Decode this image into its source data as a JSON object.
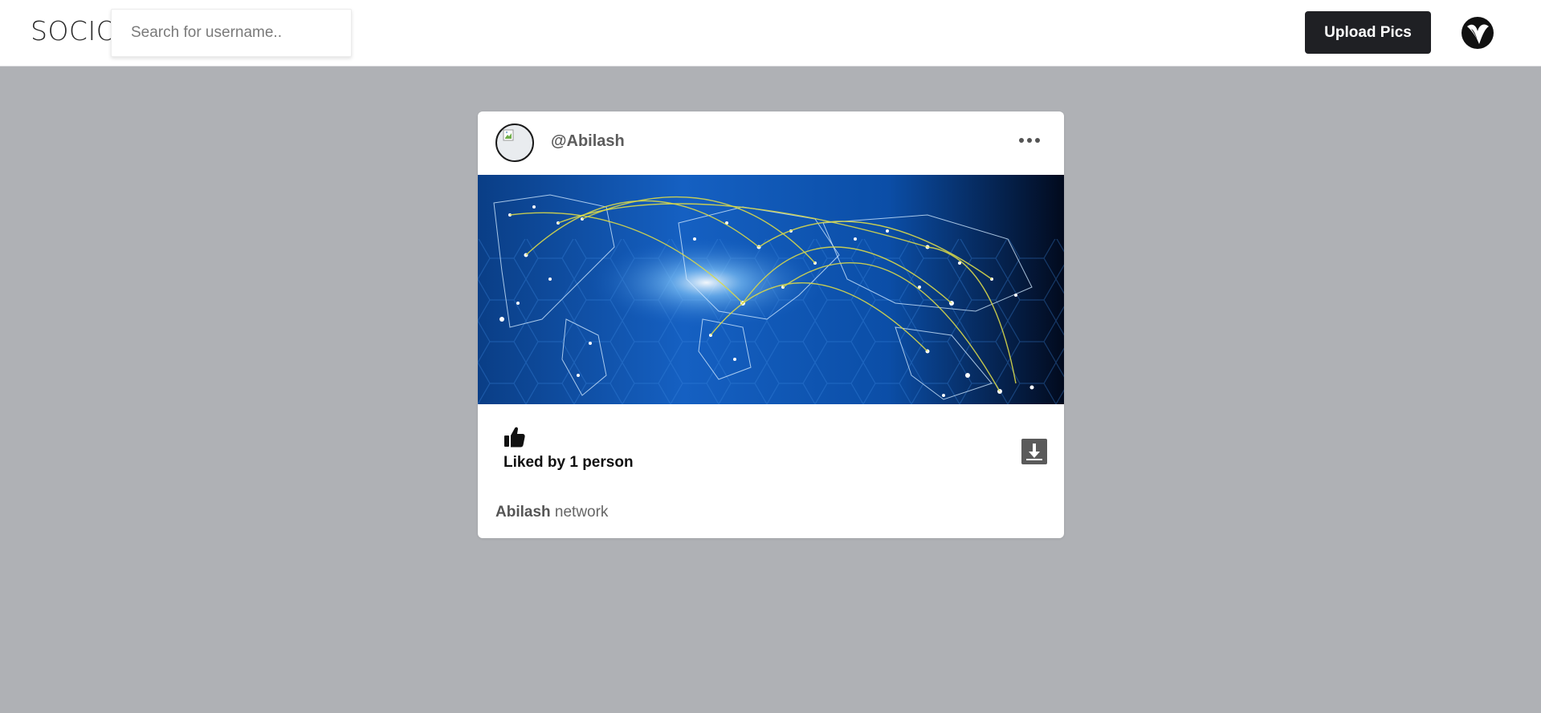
{
  "header": {
    "brand": "SOCIO",
    "search": {
      "placeholder": "Search for username.."
    },
    "upload_button": "Upload Pics",
    "profile_icon": "profile-logo-icon"
  },
  "post": {
    "username": "@Abilash",
    "avatar_icon": "broken-image-icon",
    "menu_icon": "more-horizontal-icon",
    "image": "world-network-map-image",
    "like_icon": "thumbs-up-icon",
    "likes_text": "Liked by 1 person",
    "download_icon": "download-icon",
    "caption": {
      "user": "Abilash",
      "text": "network"
    }
  },
  "colors": {
    "background": "#afb1b5",
    "topbar": "#ffffff",
    "button": "#1f2024",
    "card": "#ffffff",
    "image_blue": "#0d4fa8"
  }
}
